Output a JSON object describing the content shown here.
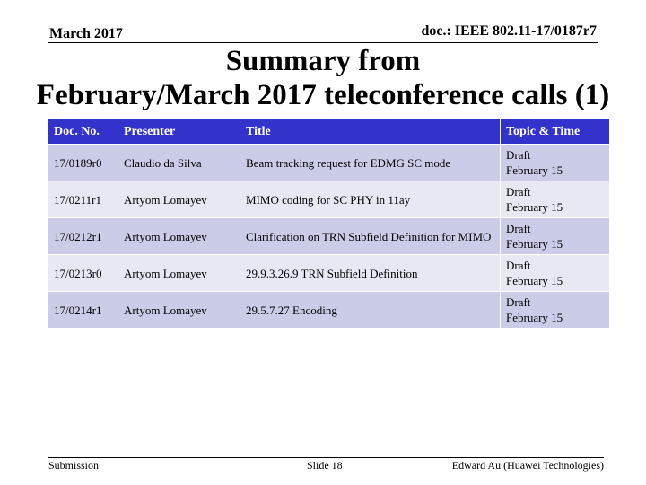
{
  "header": {
    "date": "March 2017",
    "doc_id": "doc.: IEEE 802.11-17/0187r7"
  },
  "title": {
    "line1": "Summary from",
    "line2": "February/March 2017 teleconference calls (1)"
  },
  "table": {
    "columns": [
      "Doc. No.",
      "Presenter",
      "Title",
      "Topic & Time"
    ],
    "rows": [
      {
        "doc_no": "17/0189r0",
        "presenter": "Claudio da Silva",
        "title": "Beam tracking request for EDMG SC mode",
        "topic": "Draft",
        "time": "February 15"
      },
      {
        "doc_no": "17/0211r1",
        "presenter": "Artyom Lomayev",
        "title": "MIMO coding for SC PHY in 11ay",
        "topic": "Draft",
        "time": "February 15"
      },
      {
        "doc_no": "17/0212r1",
        "presenter": "Artyom Lomayev",
        "title": "Clarification on TRN Subfield Definition for MIMO",
        "topic": "Draft",
        "time": "February 15"
      },
      {
        "doc_no": "17/0213r0",
        "presenter": "Artyom Lomayev",
        "title": "29.9.3.26.9 TRN Subfield Definition",
        "topic": "Draft",
        "time": "February 15"
      },
      {
        "doc_no": "17/0214r1",
        "presenter": "Artyom Lomayev",
        "title": "29.5.7.27 Encoding",
        "topic": "Draft",
        "time": "February 15"
      }
    ]
  },
  "footer": {
    "left": "Submission",
    "center": "Slide 18",
    "right": "Edward Au (Huawei Technologies)"
  },
  "colors": {
    "header_bg": "#3333cc",
    "row_odd_bg": "#cbcde8",
    "row_even_bg": "#e7e8f4"
  }
}
